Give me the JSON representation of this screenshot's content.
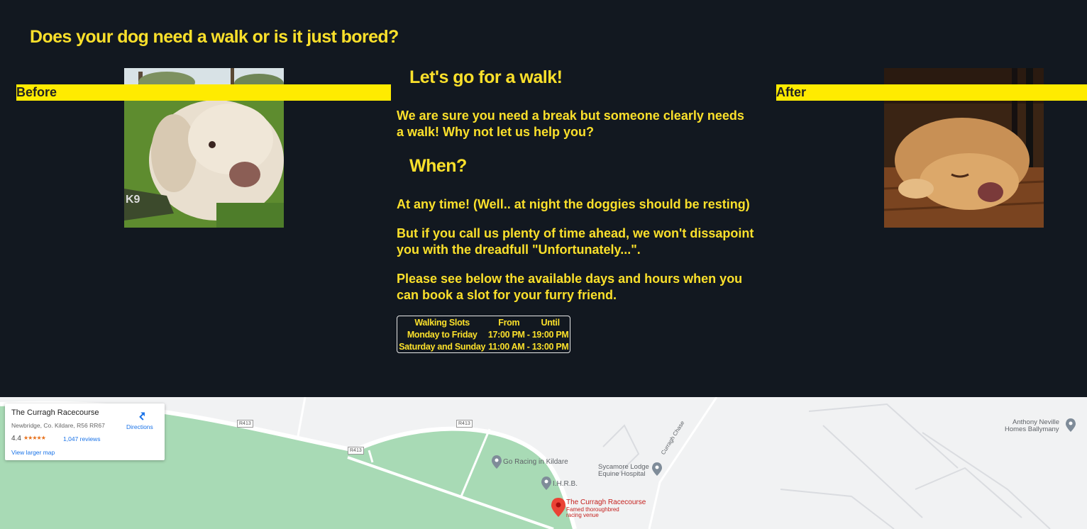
{
  "header": {
    "title": "Does your dog need a walk or is it just bored?"
  },
  "before_after": {
    "before_label": "Before",
    "after_label": "After"
  },
  "main": {
    "walk_heading": "Let's go for a walk!",
    "walk_text": "We are sure you need a break but someone clearly needs a walk! Why not let us help you?",
    "when_heading": "When?",
    "when_text_1": "At any time! (Well.. at night the doggies should be resting)",
    "when_text_2": "But if you call us plenty of time ahead, we won't dissapoint you with the dreadfull \"Unfortunately...\".",
    "when_text_3": "Please see below the available days and hours when you can book a slot for your furry friend."
  },
  "slots_table": {
    "headers": [
      "Walking Slots",
      "From",
      "Until"
    ],
    "rows": [
      [
        "Monday to Friday",
        "17:00 PM -",
        "19:00 PM"
      ],
      [
        "Saturday and Sunday",
        "11:00 AM -",
        "13:00 PM"
      ]
    ]
  },
  "map": {
    "card": {
      "name": "The Curragh Racecourse",
      "address": "Newbridge, Co. Kildare, R56 RR67",
      "rating": "4.4",
      "stars": "★★★★★",
      "reviews": "1,047 reviews",
      "larger_map": "View larger map",
      "directions": "Directions"
    },
    "labels": {
      "go_racing": "Go Racing in Kildare",
      "ihrb": "I.H.R.B.",
      "sycamore_1": "Sycamore Lodge",
      "sycamore_2": "Equine Hospital",
      "curragh_chase": "Curragh Chase",
      "anthony_1": "Anthony Neville",
      "anthony_2": "Homes Ballymany",
      "racecourse": "The Curragh Racecourse",
      "racecourse_sub_1": "Famed thoroughbred",
      "racecourse_sub_2": "racing venue",
      "road_r413": "R413"
    },
    "colors": {
      "park": "#a8dab5",
      "land": "#f1f2f3",
      "accent": "#1a73e8",
      "pin": "#ea4335"
    }
  },
  "colors": {
    "background": "#121820",
    "text": "#fbe02b",
    "band": "#ffeb00"
  }
}
